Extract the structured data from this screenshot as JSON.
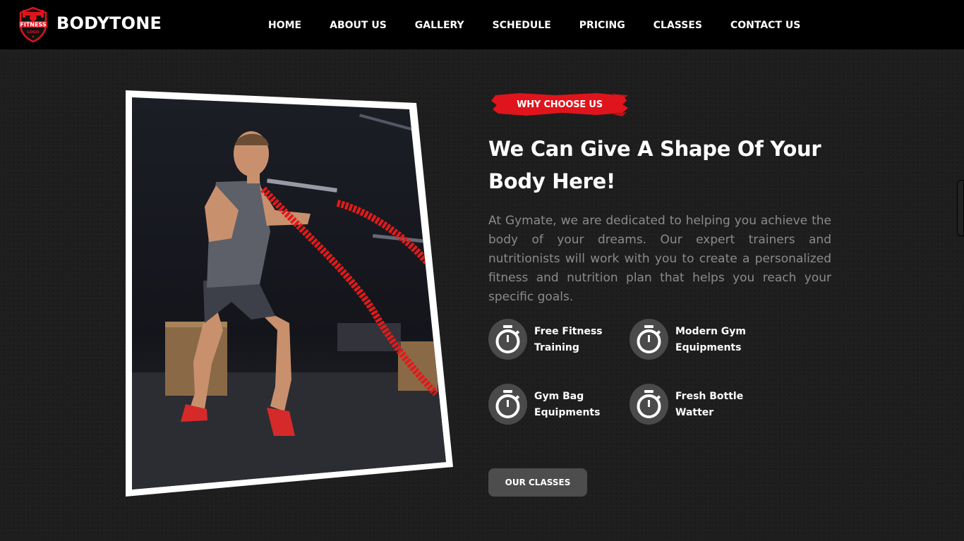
{
  "brand": {
    "name": "BODYTONE",
    "logo_text": "FITNESS",
    "logo_sub": "LOGO"
  },
  "nav": {
    "items": [
      {
        "label": "HOME"
      },
      {
        "label": "ABOUT US"
      },
      {
        "label": "GALLERY"
      },
      {
        "label": "SCHEDULE"
      },
      {
        "label": "PRICING"
      },
      {
        "label": "CLASSES"
      },
      {
        "label": "CONTACT US"
      }
    ]
  },
  "section": {
    "tag": "WHY CHOOSE US",
    "heading": "We Can Give A Shape Of Your Body Here!",
    "paragraph": "At Gymate, we are dedicated to helping you achieve the body of your dreams. Our expert trainers and nutritionists will work with you to create a personalized fitness and nutrition plan that helps you reach your specific goals.",
    "features": [
      {
        "line1": "Free Fitness",
        "line2": "Training",
        "icon": "stopwatch-icon"
      },
      {
        "line1": "Modern Gym",
        "line2": "Equipments",
        "icon": "stopwatch-icon"
      },
      {
        "line1": "Gym Bag",
        "line2": "Equipments",
        "icon": "stopwatch-icon"
      },
      {
        "line1": "Fresh Bottle",
        "line2": "Watter",
        "icon": "stopwatch-icon"
      }
    ],
    "button_label": "OUR CLASSES"
  },
  "colors": {
    "accent": "#e0141c",
    "nav_bg": "#000000",
    "page_bg": "#1e1e1e",
    "button_bg": "#4d4d4d"
  }
}
